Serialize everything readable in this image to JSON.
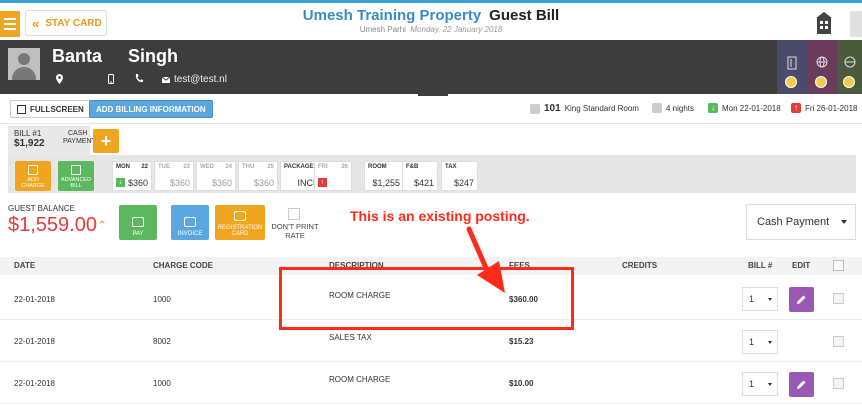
{
  "topbar": {
    "stay_card_label": "STAY CARD",
    "property_name": "Umesh Training Property",
    "page_name": "Guest Bill",
    "user_name": "Umesh Parhi",
    "date": "Monday, 22 January 2018"
  },
  "guest": {
    "first_name": "Banta",
    "last_name": "Singh",
    "email": "test@test.nl"
  },
  "toolbar": {
    "fullscreen_label": "FULLSCREEN",
    "billing_info_label": "ADD BILLING INFORMATION",
    "room_number": "101",
    "room_type": "King Standard Room",
    "nights": "4 nights",
    "arrival": "Mon 22-01-2018",
    "departure": "Fri 26-01-2018"
  },
  "bill": {
    "tab_title": "BILL #1",
    "tab_amount": "$1,922",
    "cash_line1": "CASH",
    "cash_line2": "PAYMENT",
    "add_label": "+"
  },
  "strip": {
    "add_charge_l1": "ADD",
    "add_charge_l2": "CHARGE",
    "adv_bill_l1": "ADVANCED",
    "adv_bill_l2": "BILL",
    "days": [
      {
        "day": "MON",
        "num": "22",
        "value": "$360",
        "dim": false
      },
      {
        "day": "TUE",
        "num": "23",
        "value": "$360",
        "dim": true
      },
      {
        "day": "WED",
        "num": "24",
        "value": "$360",
        "dim": true
      },
      {
        "day": "THU",
        "num": "25",
        "value": "$360",
        "dim": true
      }
    ],
    "packages_label": "PACKAGES",
    "packages_value": "INCL",
    "fri_day": "FRI",
    "fri_num": "26",
    "room_label": "ROOM",
    "room_value": "$1,255",
    "fb_label": "F&B",
    "fb_value": "$421",
    "tax_label": "TAX",
    "tax_value": "$247"
  },
  "balance": {
    "label": "GUEST BALANCE",
    "amount": "$1,559.00",
    "pay_label": "PAY",
    "invoice_label": "INVOICE",
    "reg_l1": "REGISTRATION",
    "reg_l2": "CARD",
    "dnp_label": "DON'T PRINT RATE",
    "payment_select": "Cash Payment"
  },
  "annotation": "This is an existing posting.",
  "table": {
    "headers": {
      "date": "DATE",
      "charge_code": "CHARGE CODE",
      "description": "DESCRIPTION",
      "fees": "FEES",
      "credits": "CREDITS",
      "bill": "BILL #",
      "edit": "EDIT"
    },
    "rows": [
      {
        "date": "22-01-2018",
        "code": "1000",
        "desc": "ROOM CHARGE",
        "fees": "$360.00",
        "bill": "1"
      },
      {
        "date": "22-01-2018",
        "code": "8002",
        "desc": "SALES TAX",
        "fees": "$15.23",
        "bill": "1"
      },
      {
        "date": "22-01-2018",
        "code": "1000",
        "desc": "ROOM CHARGE",
        "fees": "$10.00",
        "bill": "1"
      }
    ]
  },
  "colors": {
    "accent_orange": "#f0a520",
    "accent_blue": "#3a8cc5",
    "balance_red": "#e33c3c",
    "annotation_red": "#ff2a1a",
    "edit_purple": "#9b59b6"
  }
}
